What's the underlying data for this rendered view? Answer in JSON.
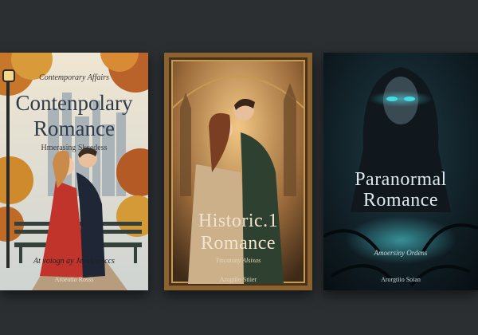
{
  "covers": [
    {
      "tagline": "Contemporary Affairs",
      "title_line1": "Contenpolary",
      "title_line2": "Romance",
      "subtitle": "Hmerasing Skcedess",
      "footer": "At voiogn ay Jeraleericcs",
      "author": "Aroeatio Rosss"
    },
    {
      "title_line1": "Historic.1",
      "title_line2": "Romance",
      "subtitle": "Tmcatony Alsixas",
      "author": "Arogtilo Stiier"
    },
    {
      "title_line1": "Paranormal",
      "title_line2": "Romance",
      "subtitle": "Amoersiny Ordens",
      "author": "Arorgtiio Soian"
    }
  ],
  "colors": {
    "background": "#2b2f31",
    "contemporary_accent": "#b8322a",
    "historical_frame": "#6e4a22",
    "paranormal_glow": "#3fe0e8"
  }
}
